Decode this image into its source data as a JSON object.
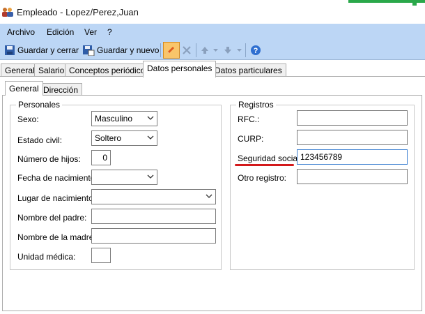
{
  "window": {
    "title": "Empleado - Lopez/Perez,Juan"
  },
  "menu": {
    "archivo": "Archivo",
    "edicion": "Edición",
    "ver": "Ver",
    "help": "?"
  },
  "toolbar": {
    "save_close": "Guardar y cerrar",
    "save_new": "Guardar y nuevo"
  },
  "tabs": [
    "General",
    "Salario",
    "Conceptos periódicos",
    "Datos personales",
    "Datos particulares"
  ],
  "subtabs": [
    "General",
    "Dirección"
  ],
  "personales": {
    "title": "Personales",
    "sexo_label": "Sexo:",
    "sexo_value": "Masculino",
    "estado_label": "Estado civil:",
    "estado_value": "Soltero",
    "hijos_label": "Número de hijos:",
    "hijos_value": "0",
    "fecha_label": "Fecha de nacimiento:",
    "fecha_value": "",
    "lugar_label": "Lugar de nacimiento:",
    "lugar_value": "",
    "padre_label": "Nombre del padre:",
    "padre_value": "",
    "madre_label": "Nombre de la madre:",
    "madre_value": "",
    "unidad_label": "Unidad médica:",
    "unidad_value": ""
  },
  "registros": {
    "title": "Registros",
    "rfc_label": "RFC.:",
    "rfc_value": "",
    "curp_label": "CURP:",
    "curp_value": "",
    "ss_label": "Seguridad social:",
    "ss_value": "123456789",
    "otro_label": "Otro registro:",
    "otro_value": ""
  },
  "colors": {
    "menubar": "#bcd6f5",
    "annotation": "#d3191b",
    "focus_border": "#3c7fd1"
  }
}
